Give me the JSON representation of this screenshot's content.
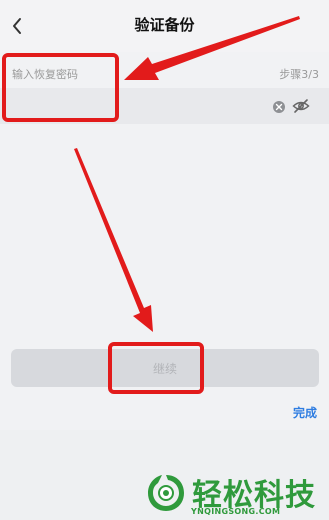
{
  "header": {
    "title": "验证备份"
  },
  "form": {
    "label": "输入恢复密码",
    "step": "步骤3/3",
    "input_value": ""
  },
  "actions": {
    "continue_label": "继续",
    "done_label": "完成"
  },
  "watermark": {
    "brand": "轻松科技",
    "url": "YNQINGSONG.COM"
  },
  "colors": {
    "annotation": "#e21b1b",
    "accent": "#2f7de1",
    "brand": "#2f9a3c"
  },
  "icons": [
    "chevron-left-icon",
    "clear-icon",
    "eye-off-icon",
    "logo-icon"
  ]
}
